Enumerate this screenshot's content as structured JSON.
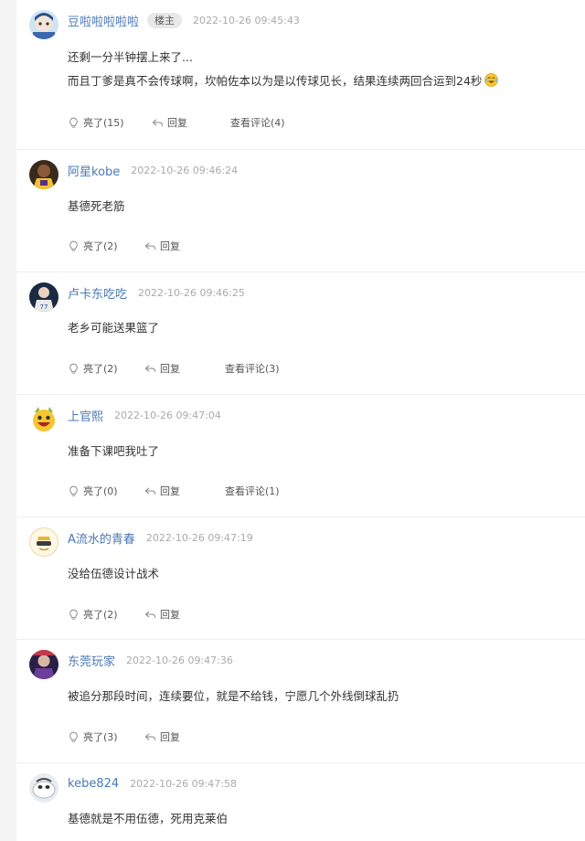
{
  "comments": [
    {
      "user": "豆啦啦啦啦啦",
      "badge": "楼主",
      "time": "2022-10-26 09:45:43",
      "lines": [
        "还剩一分半钟摆上来了...",
        "而且丁爹是真不会传球啊，坎帕佐本以为是以传球见长，结果连续两回合运到24秒"
      ],
      "emoji": "laughing-tears-emoji",
      "like": "亮了(15)",
      "reply": "回复",
      "view": "查看评论(4)"
    },
    {
      "user": "阿星kobe",
      "time": "2022-10-26 09:46:24",
      "lines": [
        "基德死老筋"
      ],
      "like": "亮了(2)",
      "reply": "回复"
    },
    {
      "user": "卢卡东吃吃",
      "time": "2022-10-26 09:46:25",
      "lines": [
        "老乡可能送果篮了"
      ],
      "like": "亮了(2)",
      "reply": "回复",
      "view": "查看评论(3)"
    },
    {
      "user": "上官熙",
      "time": "2022-10-26 09:47:04",
      "lines": [
        "准备下课吧我吐了"
      ],
      "like": "亮了(0)",
      "reply": "回复",
      "view": "查看评论(1)"
    },
    {
      "user": "A流水的青春",
      "time": "2022-10-26 09:47:19",
      "lines": [
        "没给伍德设计战术"
      ],
      "like": "亮了(2)",
      "reply": "回复"
    },
    {
      "user": "东莞玩家",
      "time": "2022-10-26 09:47:36",
      "lines": [
        "被追分那段时间，连续要位，就是不给钱，宁愿几个外线倒球乱扔"
      ],
      "like": "亮了(3)",
      "reply": "回复"
    },
    {
      "user": "kebe824",
      "time": "2022-10-26 09:47:58",
      "lines": [
        "基德就是不用伍德，死用克莱伯"
      ]
    }
  ],
  "colors": {
    "username": "#4a78b8",
    "timestamp": "#aaaaaa",
    "background": "#f4f4f4",
    "card": "#ffffff"
  },
  "icons": {
    "like": "lightbulb-icon",
    "reply": "reply-arrow-icon"
  }
}
